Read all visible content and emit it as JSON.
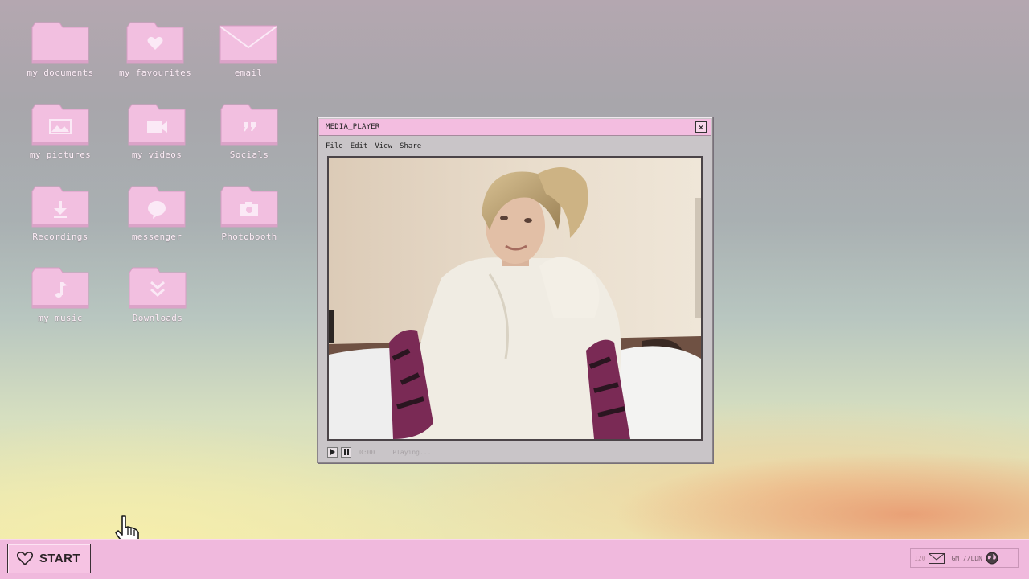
{
  "desktop": {
    "icons": [
      {
        "label": "my documents",
        "icon": "folder-icon"
      },
      {
        "label": "my favourites",
        "icon": "heart-folder-icon"
      },
      {
        "label": "email",
        "icon": "envelope-icon"
      },
      {
        "label": "my pictures",
        "icon": "picture-folder-icon"
      },
      {
        "label": "my videos",
        "icon": "video-folder-icon"
      },
      {
        "label": "Socials",
        "icon": "quote-folder-icon"
      },
      {
        "label": "Recordings",
        "icon": "download-arrow-folder-icon"
      },
      {
        "label": "messenger",
        "icon": "chat-bubble-folder-icon"
      },
      {
        "label": "Photobooth",
        "icon": "camera-folder-icon"
      },
      {
        "label": "my music",
        "icon": "music-note-folder-icon"
      },
      {
        "label": "Downloads",
        "icon": "double-chevron-down-folder-icon"
      }
    ]
  },
  "window": {
    "title": "MEDIA_PLAYER",
    "close_label": "✕",
    "menu": [
      "File",
      "Edit",
      "View",
      "Share"
    ],
    "controls": {
      "time": "0:00",
      "status": "Playing..."
    }
  },
  "taskbar": {
    "start_label": "START",
    "tray_count": "120",
    "clock": "GMT//LDN"
  },
  "colors": {
    "accent_pink": "#f0b9dd",
    "folder_pink": "#f2bfe0",
    "window_gray": "#c9c5c8"
  }
}
